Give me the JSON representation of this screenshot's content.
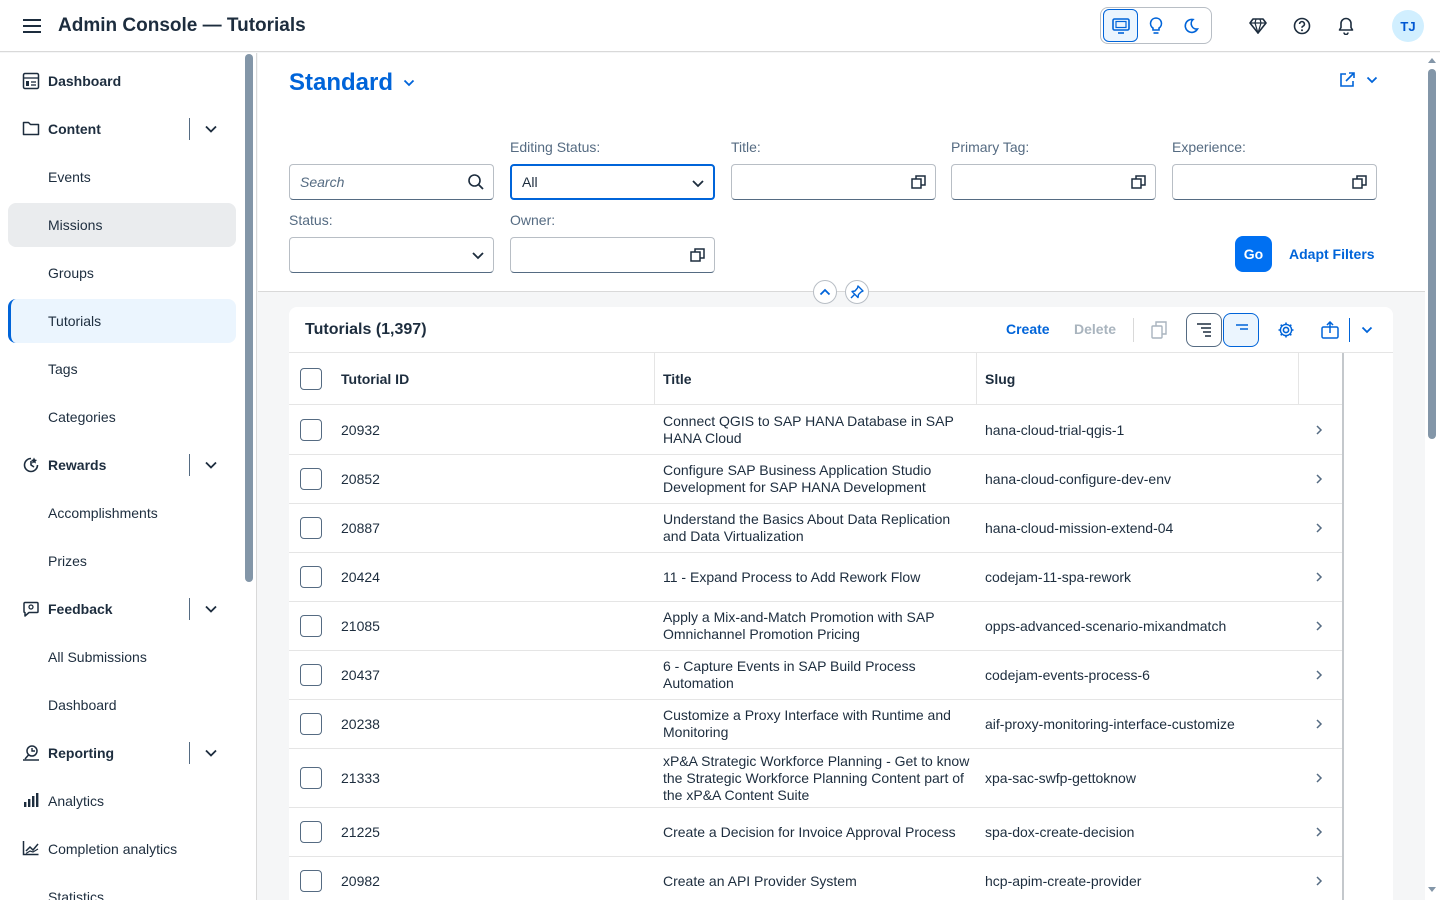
{
  "app": {
    "title": "Admin Console — Tutorials",
    "avatar_initials": "TJ"
  },
  "shell_icons": [
    "desktop-theme-icon",
    "lightbulb-theme-icon",
    "moon-theme-icon",
    "diamond-icon",
    "help-icon",
    "bell-icon"
  ],
  "sidebar": {
    "items": [
      {
        "label": "Dashboard",
        "type": "group",
        "icon": "dashboard-icon"
      },
      {
        "label": "Content",
        "type": "group",
        "icon": "folder-icon",
        "expandable": true
      },
      {
        "label": "Events",
        "type": "sub"
      },
      {
        "label": "Missions",
        "type": "sub",
        "state": "hover"
      },
      {
        "label": "Groups",
        "type": "sub"
      },
      {
        "label": "Tutorials",
        "type": "sub",
        "state": "selected"
      },
      {
        "label": "Tags",
        "type": "sub"
      },
      {
        "label": "Categories",
        "type": "sub"
      },
      {
        "label": "Rewards",
        "type": "group",
        "icon": "rewards-icon",
        "expandable": true
      },
      {
        "label": "Accomplishments",
        "type": "sub"
      },
      {
        "label": "Prizes",
        "type": "sub"
      },
      {
        "label": "Feedback",
        "type": "group",
        "icon": "feedback-icon",
        "expandable": true
      },
      {
        "label": "All Submissions",
        "type": "sub"
      },
      {
        "label": "Dashboard",
        "type": "sub"
      },
      {
        "label": "Reporting",
        "type": "group",
        "icon": "reporting-icon",
        "expandable": true
      },
      {
        "label": "Analytics",
        "type": "sub",
        "icon": "bar-chart-icon"
      },
      {
        "label": "Completion analytics",
        "type": "sub",
        "icon": "line-chart-icon"
      },
      {
        "label": "Statistics",
        "type": "sub"
      }
    ]
  },
  "variant": {
    "name": "Standard"
  },
  "filters": {
    "search_placeholder": "Search",
    "editing_status_label": "Editing Status:",
    "editing_status_value": "All",
    "title_label": "Title:",
    "primary_tag_label": "Primary Tag:",
    "experience_label": "Experience:",
    "status_label": "Status:",
    "owner_label": "Owner:",
    "go_label": "Go",
    "adapt_label": "Adapt Filters"
  },
  "table": {
    "title": "Tutorials (1,397)",
    "create_label": "Create",
    "delete_label": "Delete",
    "columns": [
      "Tutorial ID",
      "Title",
      "Slug"
    ],
    "rows": [
      {
        "id": "20932",
        "title": [
          "Connect QGIS to SAP HANA Database in SAP",
          "HANA Cloud"
        ],
        "slug": "hana-cloud-trial-qgis-1"
      },
      {
        "id": "20852",
        "title": [
          "Configure SAP Business Application Studio",
          "Development for SAP HANA Development"
        ],
        "slug": "hana-cloud-configure-dev-env"
      },
      {
        "id": "20887",
        "title": [
          "Understand the Basics About Data Replication",
          "and Data Virtualization"
        ],
        "slug": "hana-cloud-mission-extend-04"
      },
      {
        "id": "20424",
        "title": [
          "11 - Expand Process to Add Rework Flow"
        ],
        "slug": "codejam-11-spa-rework"
      },
      {
        "id": "21085",
        "title": [
          "Apply a Mix-and-Match Promotion with SAP",
          "Omnichannel Promotion Pricing"
        ],
        "slug": "opps-advanced-scenario-mixandmatch"
      },
      {
        "id": "20437",
        "title": [
          "6 - Capture Events in SAP Build Process",
          "Automation"
        ],
        "slug": "codejam-events-process-6"
      },
      {
        "id": "20238",
        "title": [
          "Customize a Proxy Interface with Runtime and",
          "Monitoring"
        ],
        "slug": "aif-proxy-monitoring-interface-customize"
      },
      {
        "id": "21333",
        "title": [
          "xP&A Strategic Workforce Planning - Get to know",
          "the Strategic Workforce Planning Content part of",
          "the xP&A Content Suite"
        ],
        "slug": "xpa-sac-swfp-gettoknow"
      },
      {
        "id": "21225",
        "title": [
          "Create a Decision for Invoice Approval Process"
        ],
        "slug": "spa-dox-create-decision"
      },
      {
        "id": "20982",
        "title": [
          "Create an API Provider System"
        ],
        "slug": "hcp-apim-create-provider"
      }
    ]
  },
  "colors": {
    "accent": "#0064d9",
    "go_button": "#0070f2",
    "text": "#1d2d3e",
    "muted": "#556b82"
  }
}
